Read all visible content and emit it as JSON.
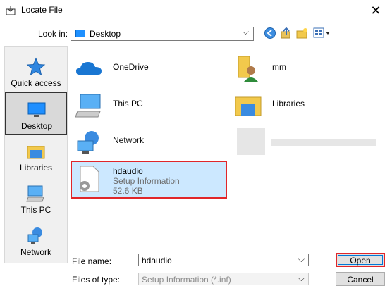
{
  "window": {
    "title": "Locate File",
    "close_glyph": "✕"
  },
  "lookin": {
    "label": "Look in:",
    "value": "Desktop"
  },
  "places": [
    {
      "label": "Quick access",
      "icon": "star-icon"
    },
    {
      "label": "Desktop",
      "icon": "desktop-icon"
    },
    {
      "label": "Libraries",
      "icon": "libraries-icon"
    },
    {
      "label": "This PC",
      "icon": "computer-icon"
    },
    {
      "label": "Network",
      "icon": "network-icon"
    }
  ],
  "items": [
    {
      "name": "OneDrive",
      "icon": "cloud-icon"
    },
    {
      "name": "mm",
      "icon": "user-folder-icon"
    },
    {
      "name": "This PC",
      "icon": "computer-icon"
    },
    {
      "name": "Libraries",
      "icon": "libraries-icon"
    },
    {
      "name": "Network",
      "icon": "network-icon"
    },
    {
      "name": "hdaudio",
      "type": "Setup Information",
      "size": "52.6 KB",
      "icon": "setup-file-icon"
    }
  ],
  "footer": {
    "filename_label": "File name:",
    "filename_value": "hdaudio",
    "filetype_label": "Files of type:",
    "filetype_value": "Setup Information (*.inf)",
    "open_label": "Open",
    "cancel_label": "Cancel"
  },
  "colors": {
    "selection": "#cce8ff",
    "highlight": "#e0262a",
    "accent": "#0078d7"
  }
}
